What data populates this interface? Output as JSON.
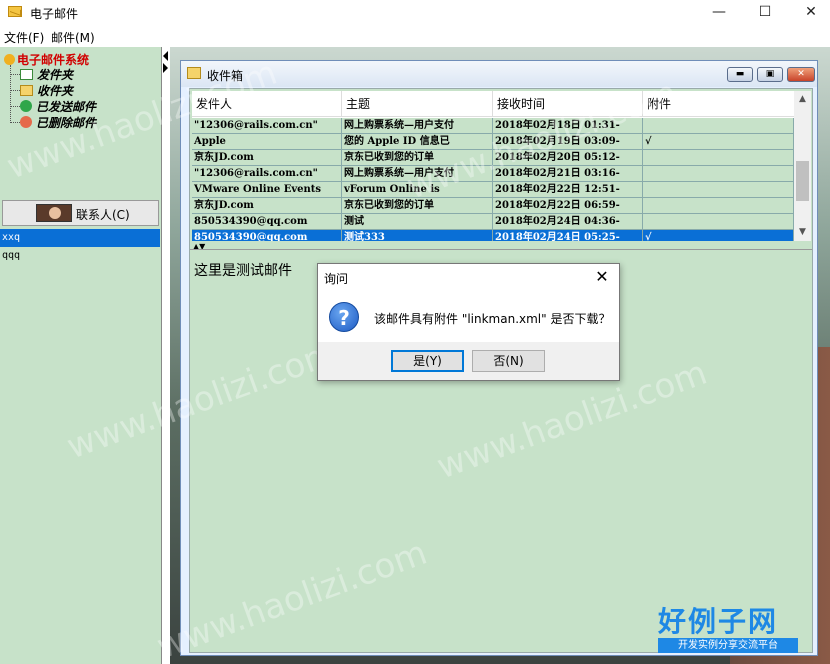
{
  "window": {
    "title": "电子邮件",
    "minimize": "—",
    "maximize": "☐",
    "close": "✕"
  },
  "menu": [
    {
      "label": "文件(F)"
    },
    {
      "label": "邮件(M)"
    }
  ],
  "tree": {
    "root": "电子邮件系统",
    "items": [
      {
        "label": "发件夹",
        "icon": "outbox-icon"
      },
      {
        "label": "收件夹",
        "icon": "folder-icon"
      },
      {
        "label": "已发送邮件",
        "icon": "check-icon"
      },
      {
        "label": "已删除邮件",
        "icon": "delete-icon"
      }
    ]
  },
  "contacts": {
    "button_label": "联系人(C)",
    "list": [
      {
        "name": "xxq",
        "selected": true
      },
      {
        "name": "qqq",
        "selected": false
      }
    ]
  },
  "inbox": {
    "title": "收件箱",
    "columns": [
      "发件人",
      "主题",
      "接收时间",
      "附件"
    ],
    "rows": [
      {
        "from": "\"12306@rails.com.cn\"",
        "subject": "网上购票系统—用户支付",
        "time": "2018年02月18日 01:31-",
        "attach": "",
        "selected": false
      },
      {
        "from": "Apple",
        "subject": "您的 Apple  ID 信息已",
        "time": "2018年02月19日 03:09-",
        "attach": "√",
        "selected": false
      },
      {
        "from": "京东JD.com",
        "subject": "京东已收到您的订单",
        "time": "2018年02月20日 05:12-",
        "attach": "",
        "selected": false
      },
      {
        "from": "\"12306@rails.com.cn\"",
        "subject": "网上购票系统—用户支付",
        "time": "2018年02月21日 03:16-",
        "attach": "",
        "selected": false
      },
      {
        "from": "VMware Online Events",
        "subject": "vForum Online is",
        "time": "2018年02月22日 12:51-",
        "attach": "",
        "selected": false
      },
      {
        "from": "京东JD.com",
        "subject": "京东已收到您的订单",
        "time": "2018年02月22日 06:59-",
        "attach": "",
        "selected": false
      },
      {
        "from": "850534390@qq.com",
        "subject": "测试",
        "time": "2018年02月24日 04:36-",
        "attach": "",
        "selected": false
      },
      {
        "from": "850534390@qq.com",
        "subject": "测试333",
        "time": "2018年02月24日 05:25-",
        "attach": "√",
        "selected": true
      }
    ],
    "body_text": "这里是测试邮件"
  },
  "dialog": {
    "title": "询问",
    "message": "该邮件具有附件 \"linkman.xml\" 是否下载？",
    "yes": "是(Y)",
    "no": "否(N)",
    "icon": "question-icon"
  },
  "watermark": {
    "text": "www.haolizi.com",
    "logo": "好例子网",
    "logo_sub": "开发实例分享交流平台"
  },
  "colors": {
    "panel_bg": "#c7e2c9",
    "selection": "#0a6fd6",
    "tree_root": "#d10000"
  }
}
